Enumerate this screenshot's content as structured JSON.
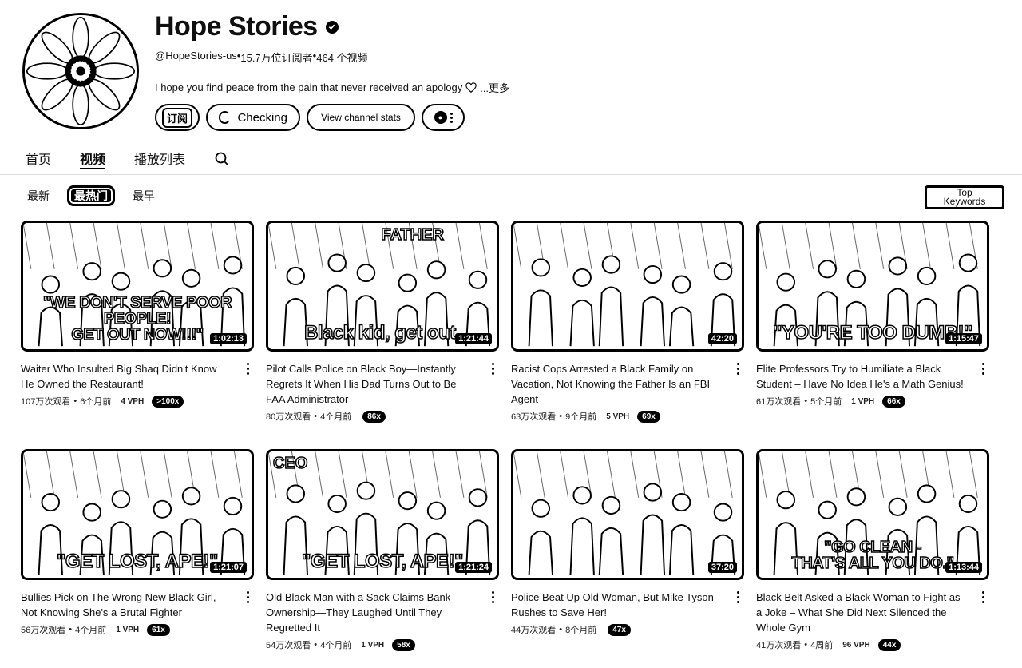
{
  "channel": {
    "name": "Hope Stories",
    "handle": "@HopeStories-us",
    "subscribers": "15.7万位订阅者",
    "video_count": "464 个视频",
    "separator": " • ",
    "description": "I hope you find peace from the pain that never received an apology",
    "more_label": "...更多"
  },
  "actions": {
    "subscribe_label": "订阅",
    "checking_label": "Checking",
    "stats_label": "View channel stats"
  },
  "tabs": [
    {
      "label": "首页",
      "active": false
    },
    {
      "label": "视频",
      "active": true
    },
    {
      "label": "播放列表",
      "active": false
    }
  ],
  "filters": [
    {
      "label": "最新",
      "active": false
    },
    {
      "label": "最热门",
      "active": true
    },
    {
      "label": "最早",
      "active": false
    }
  ],
  "top_keywords": {
    "line1": "Top",
    "line2": "Keywords"
  },
  "videos": [
    {
      "title": "Waiter Who Insulted Big Shaq Didn't Know He Owned the Restaurant!",
      "views": "107万次观看",
      "age": "6个月前",
      "vph": "4 VPH",
      "badge": ">100x",
      "duration": "1:02:13",
      "caption_line1": "\"WE DON'T SERVE POOR PEOPLE!",
      "caption_line2": "GET OUT NOW!!!\"",
      "corner": ""
    },
    {
      "title": "Pilot Calls Police on Black Boy—Instantly Regrets It When His Dad Turns Out to Be FAA Administrator",
      "views": "80万次观看",
      "age": "4个月前",
      "vph": "",
      "badge": "86x",
      "duration": "1:21:44",
      "caption_line1": "Black kid, get out.",
      "caption_line2": "",
      "corner": "FATHER"
    },
    {
      "title": "Racist Cops Arrested a Black Family on Vacation, Not Knowing the Father Is an FBI Agent",
      "views": "63万次观看",
      "age": "9个月前",
      "vph": "5 VPH",
      "badge": "69x",
      "duration": "42:20",
      "caption_line1": "",
      "caption_line2": "",
      "corner": ""
    },
    {
      "title": "Elite Professors Try to Humiliate a Black Student – Have No Idea He's a Math Genius!",
      "views": "61万次观看",
      "age": "5个月前",
      "vph": "1 VPH",
      "badge": "66x",
      "duration": "1:15:47",
      "caption_line1": "\"YOU'RE TOO DUMB!\"",
      "caption_line2": "",
      "corner": ""
    },
    {
      "title": "Bullies Pick on The Wrong New Black Girl, Not Knowing She's a Brutal Fighter",
      "views": "56万次观看",
      "age": "4个月前",
      "vph": "1 VPH",
      "badge": "61x",
      "duration": "1:21:07",
      "caption_line1": "\"GET LOST, APE!\"",
      "caption_line2": "",
      "corner": ""
    },
    {
      "title": "Old Black Man with a Sack Claims Bank Ownership—They Laughed Until They Regretted It",
      "views": "54万次观看",
      "age": "4个月前",
      "vph": "1 VPH",
      "badge": "58x",
      "duration": "1:21:24",
      "caption_line1": "\"GET LOST, APE!\"",
      "caption_line2": "",
      "corner": "CEO"
    },
    {
      "title": "Police Beat Up Old Woman, But Mike Tyson Rushes to Save Her!",
      "views": "44万次观看",
      "age": "8个月前",
      "vph": "",
      "badge": "47x",
      "duration": "37:20",
      "caption_line1": "",
      "caption_line2": "",
      "corner": ""
    },
    {
      "title": "Black Belt Asked a Black Woman to Fight as a Joke – What She Did Next Silenced the Whole Gym",
      "views": "41万次观看",
      "age": "4周前",
      "vph": "96 VPH",
      "badge": "44x",
      "duration": "1:13:44",
      "caption_line1": "\"GO CLEAN -",
      "caption_line2": "THAT'S ALL YOU DO.\"",
      "corner": ""
    }
  ]
}
